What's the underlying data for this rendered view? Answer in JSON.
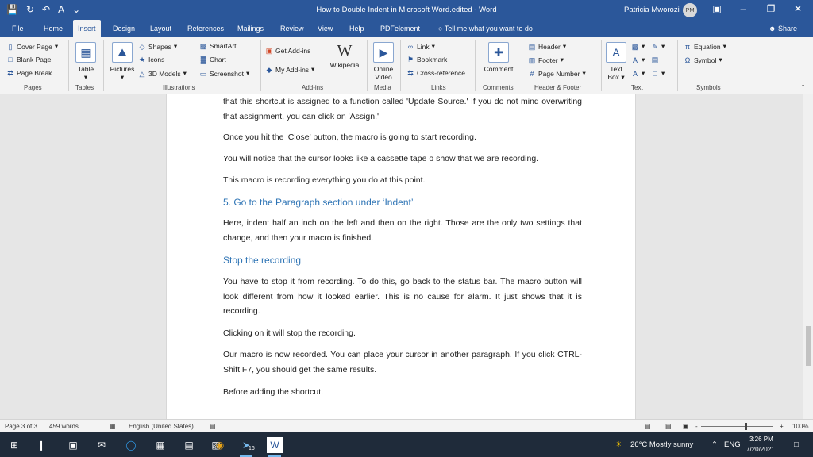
{
  "window": {
    "title": "How to Double Indent in Microsoft Word.edited  -  Word",
    "user_name": "Patricia Mworozi",
    "avatar_initials": "PM"
  },
  "quick_access": {
    "autosave_label": "A",
    "more": "⌄"
  },
  "tabs": [
    {
      "label": "File"
    },
    {
      "label": "Home"
    },
    {
      "label": "Insert"
    },
    {
      "label": "Design"
    },
    {
      "label": "Layout"
    },
    {
      "label": "References"
    },
    {
      "label": "Mailings"
    },
    {
      "label": "Review"
    },
    {
      "label": "View"
    },
    {
      "label": "Help"
    },
    {
      "label": "PDFelement"
    }
  ],
  "tell_me": "Tell me what you want to do",
  "share": "Share",
  "ribbon": {
    "pages": {
      "label": "Pages",
      "cover_page": "Cover Page",
      "blank_page": "Blank Page",
      "page_break": "Page Break"
    },
    "tables": {
      "label": "Tables",
      "table": "Table"
    },
    "illustrations": {
      "label": "Illustrations",
      "pictures": "Pictures",
      "shapes": "Shapes",
      "icons": "Icons",
      "models": "3D Models",
      "smartart": "SmartArt",
      "chart": "Chart",
      "screenshot": "Screenshot"
    },
    "addins": {
      "label": "Add-ins",
      "get_addins": "Get Add-ins",
      "my_addins": "My Add-ins",
      "wikipedia": "Wikipedia",
      "wikipedia_glyph": "W"
    },
    "media": {
      "label": "Media",
      "online_video_1": "Online",
      "online_video_2": "Video"
    },
    "links": {
      "label": "Links",
      "link": "Link",
      "bookmark": "Bookmark",
      "cross_reference": "Cross-reference"
    },
    "comments": {
      "label": "Comments",
      "comment": "Comment"
    },
    "header_footer": {
      "label": "Header & Footer",
      "header": "Header",
      "footer": "Footer",
      "page_number": "Page Number"
    },
    "text": {
      "label": "Text",
      "text_box_1": "Text",
      "text_box_2": "Box"
    },
    "symbols": {
      "label": "Symbols",
      "equation": "Equation",
      "symbol": "Symbol"
    }
  },
  "document": {
    "p1": "that this shortcut is assigned to a function called 'Update Source.' If you do not mind overwriting that assignment, you can click on 'Assign.'",
    "p2": "Once you hit the ‘Close’ button, the macro is going to start recording.",
    "p3": "You will notice that the cursor looks like a cassette tape o show that we are recording.",
    "p4": "This macro is recording everything you do at this point.",
    "h1": "5.  Go to the Paragraph section under ‘Indent’",
    "p5": "Here, indent half an inch on the left and then on the right. Those are the only two settings that change, and then your macro is finished.",
    "h2": "Stop the recording",
    "p6": "You have to stop it from recording. To do this, go back to the status bar. The macro button will look different from how it looked earlier. This is no cause for alarm. It just shows that it is recording.",
    "p7": "Clicking on it will stop the recording.",
    "p8": "Our macro is now recorded. You can place your cursor in another paragraph. If you click CTRL-Shift F7, you should get the same results.",
    "p9": "Before adding the shortcut."
  },
  "status": {
    "page": "Page 3 of 3",
    "words": "459 words",
    "language": "English (United States)",
    "zoom_minus": "-",
    "zoom_plus": "+",
    "zoom": "100%"
  },
  "taskbar": {
    "weather": "26°C  Mostly sunny",
    "lang": "ENG",
    "time": "3:26 PM",
    "date": "7/20/2021",
    "badge": "16"
  }
}
